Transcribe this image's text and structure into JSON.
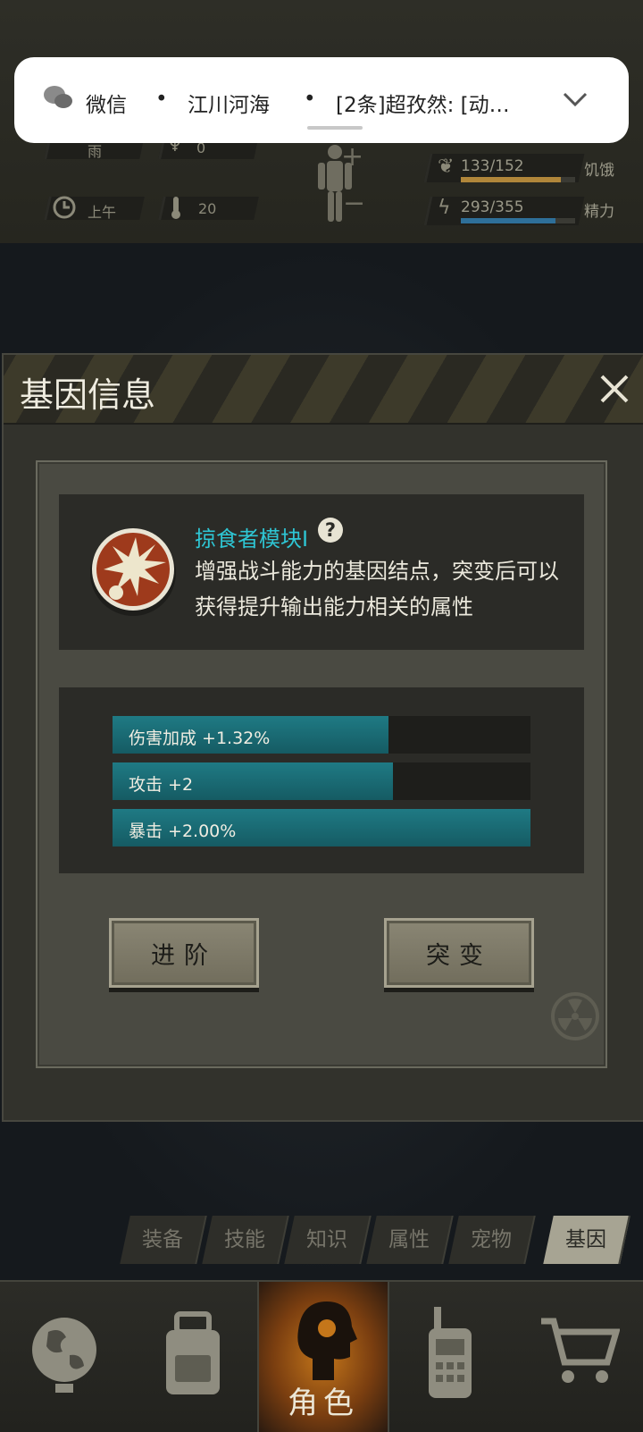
{
  "hud": {
    "weather": "雨",
    "weather_count": "0",
    "time": "上午",
    "temperature": "20",
    "hunger_value": "133/152",
    "hunger_label": "饥饿",
    "hunger_fraction": 0.875,
    "energy_value": "293/355",
    "energy_label": "精力",
    "energy_fraction": 0.825
  },
  "notification": {
    "app": "微信",
    "sender": "江川河海",
    "message": "[2条]超孜然: [动…"
  },
  "panel": {
    "title": "基因信息",
    "gene_name": "掠食者模块Ⅰ",
    "description": "增强战斗能力的基因结点，突变后可以获得提升输出能力相关的属性",
    "attributes": [
      {
        "label": "伤害加成 +1.32%",
        "fraction": 0.66
      },
      {
        "label": "攻击 +2",
        "fraction": 0.67
      },
      {
        "label": "暴击 +2.00%",
        "fraction": 1.0
      }
    ],
    "advance_button": "进阶",
    "mutate_button": "突变"
  },
  "tabs": [
    "装备",
    "技能",
    "知识",
    "属性",
    "宠物",
    "基因"
  ],
  "active_tab": "基因",
  "bottom_nav": {
    "items": [
      "globe-icon",
      "backpack-icon",
      "character-icon",
      "walkie-talkie-icon",
      "cart-icon"
    ],
    "active_label": "角色"
  },
  "colors": {
    "accent_cyan": "#2ec6d4",
    "attr_fill": "#1f7a84",
    "hunger_bar": "#b0863a",
    "energy_bar": "#2e6f99",
    "active_nav": "#c4761a"
  }
}
